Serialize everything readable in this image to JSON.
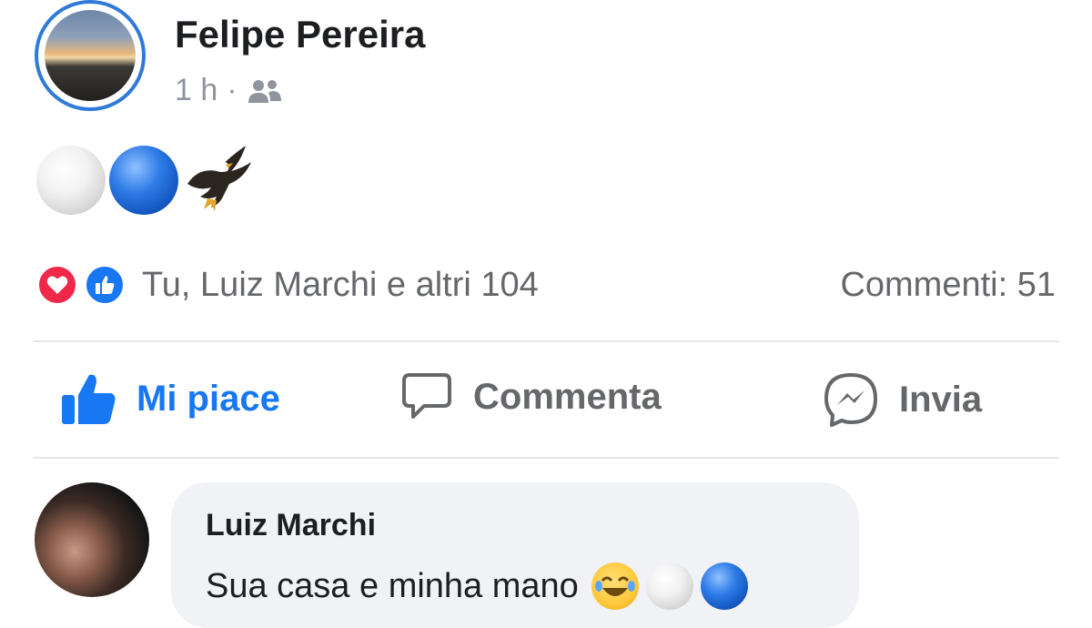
{
  "post": {
    "author": "Felipe Pereira",
    "time": "1 h",
    "separator": "·",
    "audience_icon": "friends-icon",
    "content_emojis": [
      "white-circle",
      "blue-circle",
      "eagle"
    ]
  },
  "reactions": {
    "icons": [
      "love-reaction-icon",
      "like-reaction-icon"
    ],
    "summary": "Tu, Luiz Marchi e altri 104",
    "comments": "Commenti: 51"
  },
  "actions": {
    "like": "Mi piace",
    "comment": "Commenta",
    "send": "Invia"
  },
  "comment": {
    "author": "Luiz Marchi",
    "text": "Sua casa e minha mano",
    "emojis": [
      "face-with-tears-of-joy",
      "white-circle",
      "blue-circle"
    ]
  },
  "colors": {
    "accent": "#1877f2",
    "love": "#f02849",
    "muted_text": "#65676b",
    "bubble": "#f0f2f5"
  }
}
